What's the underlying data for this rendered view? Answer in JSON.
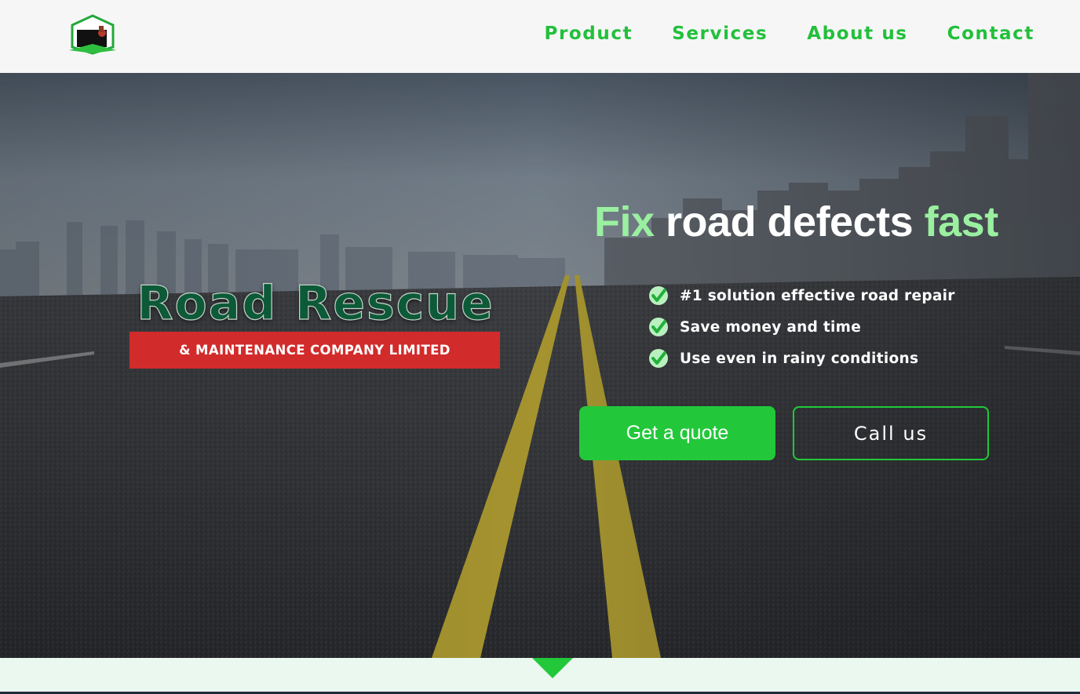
{
  "nav": {
    "logo_icon": "road-roller-house-logo",
    "items": [
      {
        "label": "Product"
      },
      {
        "label": "Services"
      },
      {
        "label": "About us"
      },
      {
        "label": "Contact"
      }
    ]
  },
  "hero": {
    "background": "city-highway-road-photo",
    "brand": {
      "title": "Road Rescue",
      "subtitle": "& MAINTENANCE COMPANY LIMITED"
    },
    "headline": {
      "word1": "Fix",
      "middle": " road defects ",
      "word3": "fast"
    },
    "features": [
      {
        "icon": "check-circle-icon",
        "text": "#1 solution effective road repair"
      },
      {
        "icon": "check-circle-icon",
        "text": "Save money and time"
      },
      {
        "icon": "check-circle-icon",
        "text": "Use even in rainy conditions"
      }
    ],
    "buttons": {
      "quote_label": "Get a quote",
      "call_label": "Call us"
    }
  },
  "colors": {
    "accent_green": "#22c83a",
    "headline_accent": "#9af0a0",
    "brand_red": "#d22b2b",
    "brand_title": "#0d5a38"
  },
  "scroll_indicator": {
    "icon": "down-arrow-icon"
  }
}
